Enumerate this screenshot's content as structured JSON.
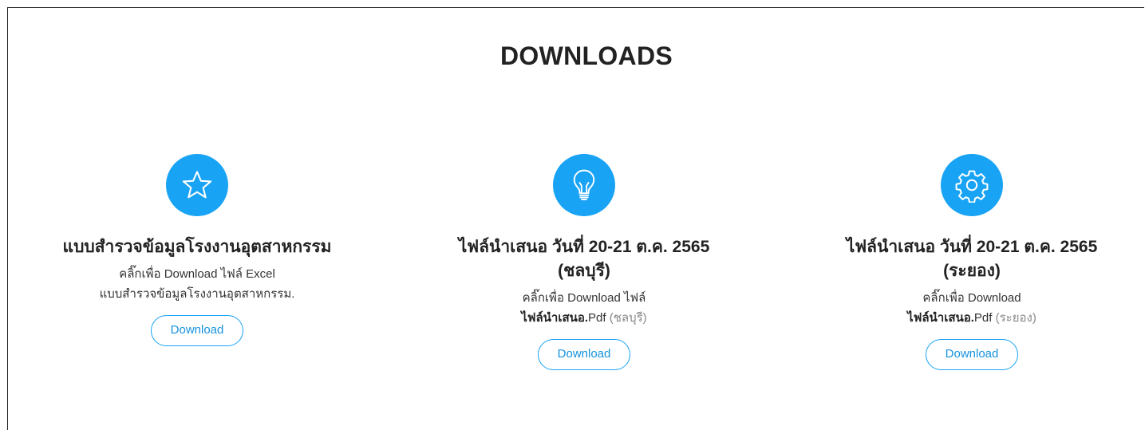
{
  "page": {
    "title": "DOWNLOADS"
  },
  "accent_color": "#18a3f5",
  "cards": [
    {
      "icon": "star-icon",
      "title_line1": "แบบสำรวจข้อมูลโรงงานอุตสาหกรรม",
      "title_line2": "",
      "desc_line1": "คลิ๊กเพื่อ Download ไฟล์ Excel",
      "desc_line2": "แบบสำรวจข้อมูลโรงงานอุตสาหกรรม.",
      "button": "Download"
    },
    {
      "icon": "lightbulb-icon",
      "title_line1": "ไฟล์นำเสนอ วันที่ 20-21 ต.ค. 2565",
      "title_line2": "(ชลบุรี)",
      "desc_line1": "คลิ๊กเพื่อ Download ไฟล์",
      "desc_bold": "ไฟล์นำเสนอ.",
      "desc_ext": "Pdf",
      "desc_place": "(ชลบุรี)",
      "button": "Download"
    },
    {
      "icon": "gear-icon",
      "title_line1": "ไฟล์นำเสนอ วันที่ 20-21 ต.ค. 2565",
      "title_line2": "(ระยอง)",
      "desc_line1": "คลิ๊กเพื่อ Download",
      "desc_bold": "ไฟล์นำเสนอ.",
      "desc_ext": "Pdf",
      "desc_place": "(ระยอง)",
      "button": "Download"
    }
  ]
}
